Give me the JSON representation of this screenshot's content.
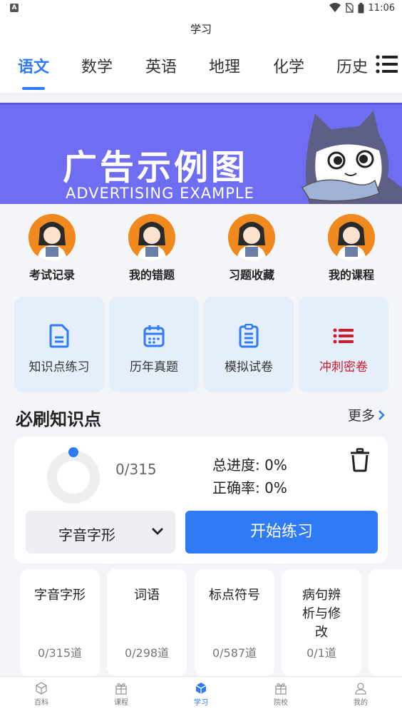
{
  "status_bar": {
    "time": "11:06",
    "badge": "A"
  },
  "header": {
    "title": "学习"
  },
  "tabs": [
    {
      "label": "语文",
      "active": true
    },
    {
      "label": "数学",
      "active": false
    },
    {
      "label": "英语",
      "active": false
    },
    {
      "label": "地理",
      "active": false
    },
    {
      "label": "化学",
      "active": false
    },
    {
      "label": "历史",
      "active": false
    }
  ],
  "banner": {
    "title": "广告示例图",
    "subtitle": "ADVERTISING EXAMPLE",
    "bg_color": "#6f6ef3"
  },
  "quick_links": [
    {
      "label": "考试记录"
    },
    {
      "label": "我的错题"
    },
    {
      "label": "习题收藏"
    },
    {
      "label": "我的课程"
    }
  ],
  "tools": [
    {
      "label": "知识点练习",
      "icon": "document-icon"
    },
    {
      "label": "历年真题",
      "icon": "calendar-icon"
    },
    {
      "label": "模拟试卷",
      "icon": "clipboard-icon"
    },
    {
      "label": "冲刺密卷",
      "icon": "list-icon",
      "accent": "#d0192a"
    }
  ],
  "section": {
    "title": "必刷知识点",
    "more": "更多"
  },
  "progress": {
    "count": "0/315",
    "total_progress": "总进度: 0%",
    "accuracy": "正确率: 0%",
    "select_value": "字音字形",
    "start_button": "开始练习"
  },
  "categories": [
    {
      "name": "字音字形",
      "count": "0/315道"
    },
    {
      "name": "词语",
      "count": "0/298道"
    },
    {
      "name": "标点符号",
      "count": "0/587道"
    },
    {
      "name": "病句辨析与修改",
      "count": "0/1道"
    }
  ],
  "bottom_nav": [
    {
      "label": "百科",
      "active": false
    },
    {
      "label": "课程",
      "active": false
    },
    {
      "label": "学习",
      "active": true
    },
    {
      "label": "院校",
      "active": false
    },
    {
      "label": "我的",
      "active": false
    }
  ],
  "colors": {
    "accent": "#2f7bf5",
    "danger": "#d0192a",
    "tool_bg": "#e4effb"
  }
}
